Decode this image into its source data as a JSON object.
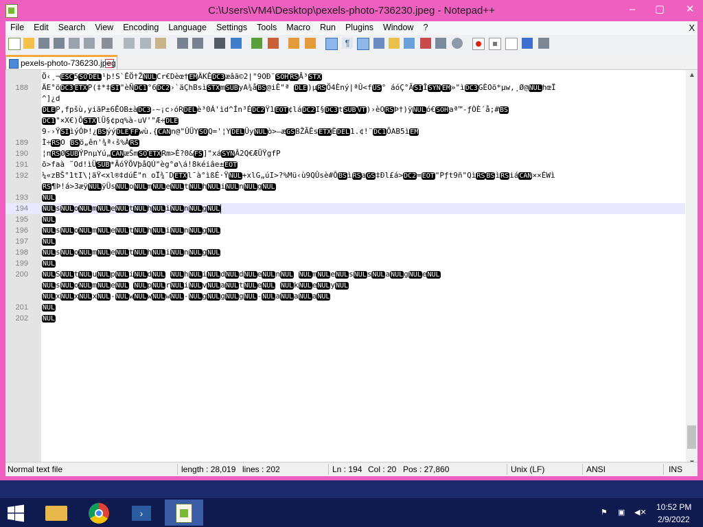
{
  "window": {
    "title": "C:\\Users\\VM4\\Desktop\\pexels-photo-736230.jpeg - Notepad++",
    "minimize": "–",
    "maximize": "▢",
    "close": "✕"
  },
  "menu": {
    "items": [
      "File",
      "Edit",
      "Search",
      "View",
      "Encoding",
      "Language",
      "Settings",
      "Tools",
      "Macro",
      "Run",
      "Plugins",
      "Window",
      "?"
    ],
    "close": "X"
  },
  "tab": {
    "label": "pexels-photo-736230.jpeg",
    "close": "x"
  },
  "editor": {
    "lines": [
      {
        "num": "",
        "text": "Ö‹¸¬ESC5SODEL¹þ!S`ÊÖ†ŽNULCr€Dèœ†EMÄKÊDC3æâã©2|\"9OÐ¨SOHRSÂ³STX"
      },
      {
        "num": "188",
        "text": "ÄE°öDC3ETXP(‡*‡SI\"èÑDC1°6DC2›`äÇhBsìSTXmSUByA¾åBS@iÊ\"ª DLE)µRSÖ4Èný|ªÛ<fUS°  áóÇ°ÃSIÎSYNEM»\"ìDC3GÈOõ*µw,¸Ø@NULhœÏ"
      },
      {
        "num": "",
        "text": "^]¿d"
      },
      {
        "num": "",
        "text": "DLEP,fpšù,yiãP±6ÊOB±àDC3-~¡c›óRDELè³0Á'ìd^Ín³ÉDC2Ÿ1EOT¢láDC2I§DC3tSUBVT)›èORSÞ†)ÿNULó€SOHaª™-ƒÒÈ´å;#BS"
      },
      {
        "num": "",
        "text": "DC1\"×X€)ÕSTXlÜ§¢pq%à-uV'\"Æ÷DLE"
      },
      {
        "num": "",
        "text": "9-›ŸSIìýÓÞ!¿BSýýDLEFFwù.{CANn@\"ÛÜYSOQ='¦YDELÜyNULò>—æGSBŽÃÊsETXËDEL1.¢!¨DC1ÕAB5ìEM"
      },
      {
        "num": "189",
        "text": "Ì÷RSO BSö„ên'¾ª‹š%ÀRS"
      },
      {
        "num": "190",
        "text": "¦nRSØSUBÝPnµYú„CANæŠmSOETXRm>È?0&FS]\"xáSYNÂ2Q€ÆÜŸgfP"
      },
      {
        "num": "191",
        "text": "õ>faà   ˜Od!ìÜSUB*ÃóŸÕVþåQÚ\"èg°ø\\á!8kéiâe±EOT"
      },
      {
        "num": "192",
        "text": "¼«zBŠ°1tI\\¦äŸ<xl®‡dúË\"n oÏ¾¯DETXl¯à°ìßÉ·ŸNUL+xlG„úI>?%Mü‹ù9QÛsè#ÔBSìRSaGS‡Ðl£á>DC2=EOT\"Pƒt9ñ\"QìRSBSìRSiáCAN××ÉWì"
      },
      {
        "num": "",
        "text": "RS¶Þ!á>3æÿNULÿÜsNULoNULmNULeNULtNULhNULiNULnNULgNUL"
      },
      {
        "num": "193",
        "text": "NUL"
      },
      {
        "num": "194",
        "text": "NULsNULoNULmNULeNULtNULhNULiNULnNULgNUL"
      },
      {
        "num": "195",
        "text": "NUL"
      },
      {
        "num": "196",
        "text": "NULsNULoNULmNULeNULtNULhNULiNULnNULgNUL"
      },
      {
        "num": "197",
        "text": "NUL"
      },
      {
        "num": "198",
        "text": "NULsNULoNULmNULeNULtNULhNULiNULnNULgNUL"
      },
      {
        "num": "199",
        "text": "NUL"
      },
      {
        "num": "200",
        "text": "NULSNULtNULuNULpNULiNULdNUL NULhNULiNULdNULdNULeNULnNUL NULmNULeNULsNULsNULaNULgNULeNUL"
      },
      {
        "num": "",
        "text": "NULsNULoNULmNULeNUL NULpNULrNULiNULvNULaNULtNULeNUL NULkNULeNULyNUL"
      },
      {
        "num": "",
        "text": "NULxNULxNULxNUL-NULwNULwNULwNUL-NULgNULgNULgNUL-NULaNULaNULaNUL"
      },
      {
        "num": "201",
        "text": "NUL"
      },
      {
        "num": "202",
        "text": "NUL"
      }
    ]
  },
  "status": {
    "filetype": "Normal text file",
    "length": "length : 28,019",
    "lines": "lines : 202",
    "ln": "Ln : 194",
    "col": "Col : 20",
    "pos": "Pos : 27,860",
    "eol": "Unix (LF)",
    "encoding": "ANSI",
    "mode": "INS"
  },
  "clock": {
    "time": "10:52 PM",
    "date": "2/9/2022"
  },
  "icons": {
    "toolbar": [
      "new-file-icon",
      "open-file-icon",
      "save-icon",
      "save-all-icon",
      "close-icon",
      "close-all-icon",
      "print-icon",
      "cut-icon",
      "copy-icon",
      "paste-icon",
      "undo-icon",
      "redo-icon",
      "find-icon",
      "replace-icon",
      "zoom-in-icon",
      "zoom-out-icon",
      "sync-vertical-icon",
      "sync-horizontal-icon",
      "word-wrap-icon",
      "show-all-chars-icon",
      "indent-guide-icon",
      "language-icon",
      "document-map-icon",
      "function-list-icon",
      "folder-as-workspace-icon",
      "monitoring-icon",
      "record-macro-icon",
      "stop-record-icon",
      "play-macro-icon",
      "run-macro-multiple-icon",
      "save-macro-icon"
    ]
  },
  "colors": {
    "window_border": "#ef5fc0",
    "taskbar": "#0f1a4f",
    "current_line": "#e8e8ff",
    "tab_accent": "#f9a73a"
  }
}
